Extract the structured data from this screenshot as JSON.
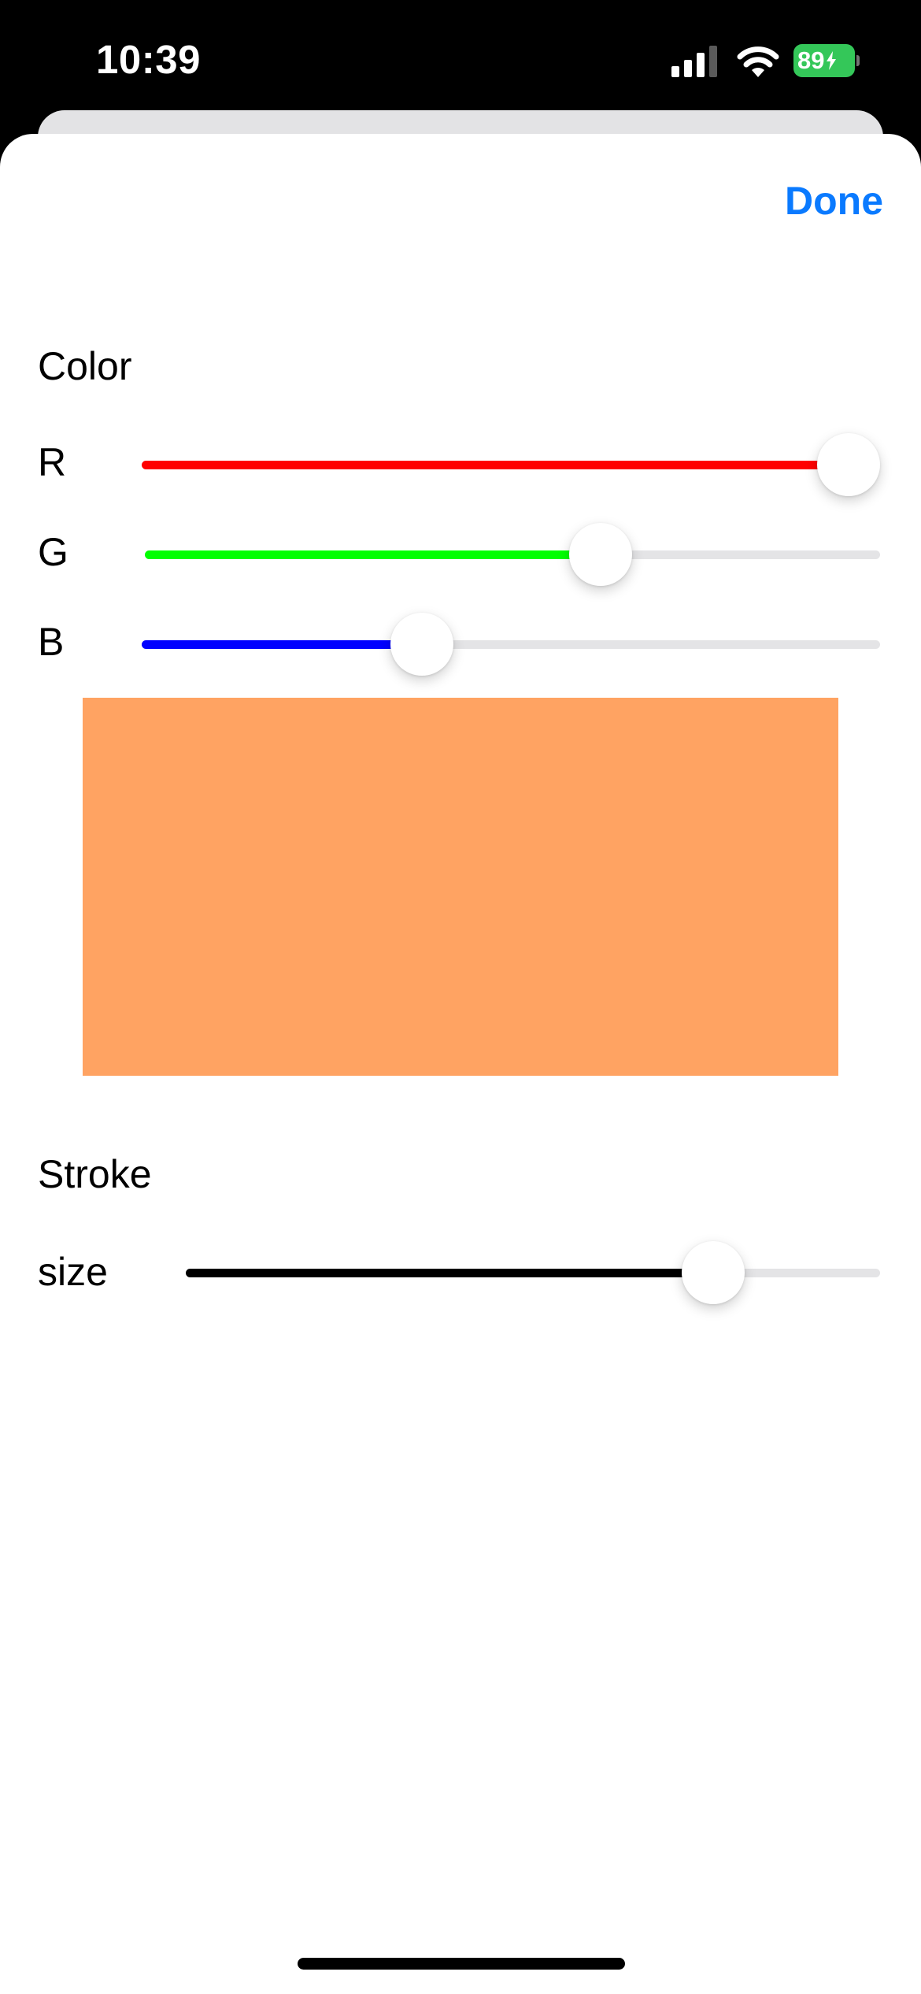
{
  "status_bar": {
    "time": "10:39",
    "battery": "89",
    "icons": [
      "signal-icon",
      "wifi-icon",
      "battery-charging-icon"
    ]
  },
  "toolbar": {
    "done_label": "Done"
  },
  "color_section": {
    "title": "Color",
    "sliders": [
      {
        "label": "R",
        "value": 1.0,
        "color": "#ff0000"
      },
      {
        "label": "G",
        "value": 0.62,
        "color": "#00ff00"
      },
      {
        "label": "B",
        "value": 0.38,
        "color": "#0000ff"
      }
    ],
    "preview_color": "#ffa362"
  },
  "stroke_section": {
    "title": "Stroke",
    "size_label": "size",
    "size_value": 0.76,
    "color": "#000000"
  }
}
